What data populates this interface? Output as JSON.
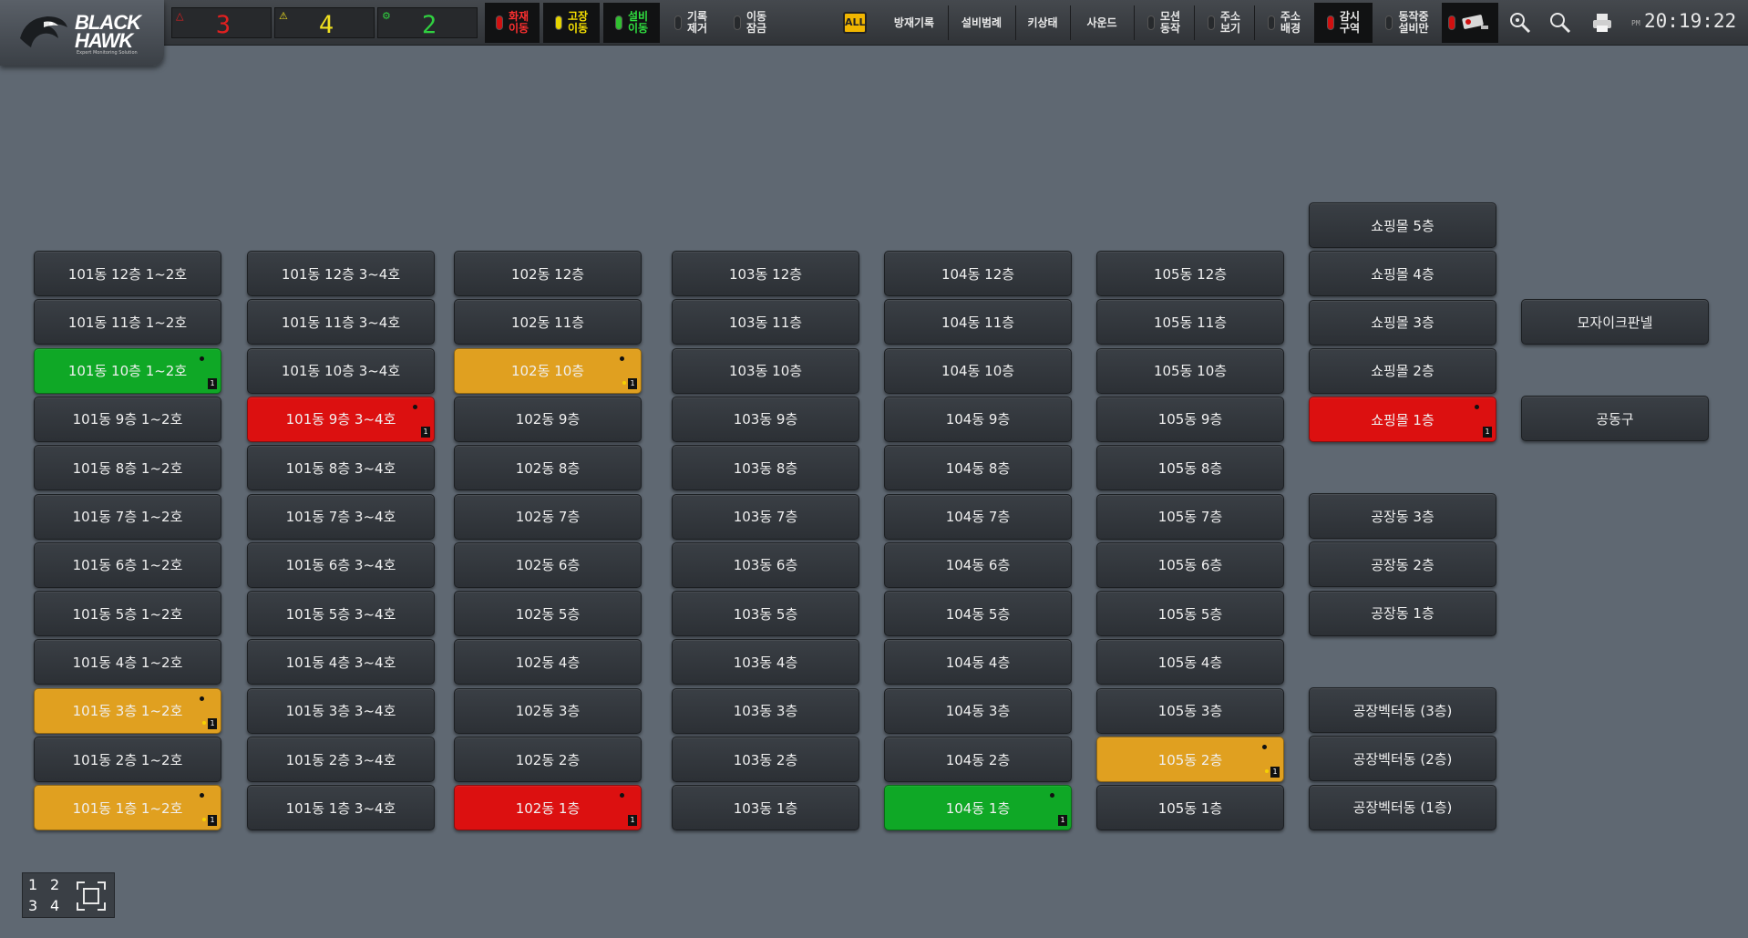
{
  "app": {
    "brand_line1": "BLACK",
    "brand_line2": "HAWK",
    "tagline": "Expert Monitoring Solution"
  },
  "counters": [
    {
      "icon": "fire-alarm-icon",
      "value": "3",
      "color": "#e02020"
    },
    {
      "icon": "warning-icon",
      "value": "4",
      "color": "#f0e020"
    },
    {
      "icon": "equipment-icon",
      "value": "2",
      "color": "#30d040"
    }
  ],
  "toolbar": {
    "fire_move": "화재\n이동",
    "fault_move": "고장\n이동",
    "equip_move": "설비\n이동",
    "clear_log": "기록\n제거",
    "move_lock": "이동\n잠금",
    "all_label": "ALL",
    "fire_log": "방재기록",
    "equip_list": "설비범례",
    "key_status": "키상태",
    "sound": "사운드",
    "mosin_action": "모션\n동작",
    "addr_view": "주소\n보기",
    "addr_change": "주소\n배경",
    "watch_zone": "감시\n구역",
    "running_only": "동작중\n설비만",
    "clock_ampm": "PM",
    "clock_time": "20:19:22"
  },
  "columns": [
    {
      "id": "101a",
      "cells": [
        {
          "label": "101동 12층 1~2호",
          "status": "normal"
        },
        {
          "label": "101동 11층 1~2호",
          "status": "normal"
        },
        {
          "label": "101동 10층 1~2호",
          "status": "green"
        },
        {
          "label": "101동 9층 1~2호",
          "status": "normal"
        },
        {
          "label": "101동 8층 1~2호",
          "status": "normal"
        },
        {
          "label": "101동 7층 1~2호",
          "status": "normal"
        },
        {
          "label": "101동 6층 1~2호",
          "status": "normal"
        },
        {
          "label": "101동 5층 1~2호",
          "status": "normal"
        },
        {
          "label": "101동 4층 1~2호",
          "status": "normal"
        },
        {
          "label": "101동 3층 1~2호",
          "status": "orange"
        },
        {
          "label": "101동 2층 1~2호",
          "status": "normal"
        },
        {
          "label": "101동 1층 1~2호",
          "status": "orange"
        }
      ]
    },
    {
      "id": "101b",
      "cells": [
        {
          "label": "101동 12층 3~4호",
          "status": "normal"
        },
        {
          "label": "101동 11층 3~4호",
          "status": "normal"
        },
        {
          "label": "101동 10층 3~4호",
          "status": "normal"
        },
        {
          "label": "101동 9층 3~4호",
          "status": "red"
        },
        {
          "label": "101동 8층 3~4호",
          "status": "normal"
        },
        {
          "label": "101동 7층 3~4호",
          "status": "normal"
        },
        {
          "label": "101동 6층 3~4호",
          "status": "normal"
        },
        {
          "label": "101동 5층 3~4호",
          "status": "normal"
        },
        {
          "label": "101동 4층 3~4호",
          "status": "normal"
        },
        {
          "label": "101동 3층 3~4호",
          "status": "normal"
        },
        {
          "label": "101동 2층 3~4호",
          "status": "normal"
        },
        {
          "label": "101동 1층 3~4호",
          "status": "normal"
        }
      ]
    },
    {
      "id": "102",
      "cells": [
        {
          "label": "102동 12층",
          "status": "normal"
        },
        {
          "label": "102동 11층",
          "status": "normal"
        },
        {
          "label": "102동 10층",
          "status": "orange"
        },
        {
          "label": "102동 9층",
          "status": "normal"
        },
        {
          "label": "102동 8층",
          "status": "normal"
        },
        {
          "label": "102동 7층",
          "status": "normal"
        },
        {
          "label": "102동 6층",
          "status": "normal"
        },
        {
          "label": "102동 5층",
          "status": "normal"
        },
        {
          "label": "102동 4층",
          "status": "normal"
        },
        {
          "label": "102동 3층",
          "status": "normal"
        },
        {
          "label": "102동 2층",
          "status": "normal"
        },
        {
          "label": "102동 1층",
          "status": "red"
        }
      ]
    },
    {
      "id": "103",
      "cells": [
        {
          "label": "103동 12층",
          "status": "normal"
        },
        {
          "label": "103동 11층",
          "status": "normal"
        },
        {
          "label": "103동 10층",
          "status": "normal"
        },
        {
          "label": "103동 9층",
          "status": "normal"
        },
        {
          "label": "103동 8층",
          "status": "normal"
        },
        {
          "label": "103동 7층",
          "status": "normal"
        },
        {
          "label": "103동 6층",
          "status": "normal"
        },
        {
          "label": "103동 5층",
          "status": "normal"
        },
        {
          "label": "103동 4층",
          "status": "normal"
        },
        {
          "label": "103동 3층",
          "status": "normal"
        },
        {
          "label": "103동 2층",
          "status": "normal"
        },
        {
          "label": "103동 1층",
          "status": "normal"
        }
      ]
    },
    {
      "id": "104",
      "cells": [
        {
          "label": "104동 12층",
          "status": "normal"
        },
        {
          "label": "104동 11층",
          "status": "normal"
        },
        {
          "label": "104동 10층",
          "status": "normal"
        },
        {
          "label": "104동 9층",
          "status": "normal"
        },
        {
          "label": "104동 8층",
          "status": "normal"
        },
        {
          "label": "104동 7층",
          "status": "normal"
        },
        {
          "label": "104동 6층",
          "status": "normal"
        },
        {
          "label": "104동 5층",
          "status": "normal"
        },
        {
          "label": "104동 4층",
          "status": "normal"
        },
        {
          "label": "104동 3층",
          "status": "normal"
        },
        {
          "label": "104동 2층",
          "status": "normal"
        },
        {
          "label": "104동 1층",
          "status": "green"
        }
      ]
    },
    {
      "id": "105",
      "cells": [
        {
          "label": "105동 12층",
          "status": "normal"
        },
        {
          "label": "105동 11층",
          "status": "normal"
        },
        {
          "label": "105동 10층",
          "status": "normal"
        },
        {
          "label": "105동 9층",
          "status": "normal"
        },
        {
          "label": "105동 8층",
          "status": "normal"
        },
        {
          "label": "105동 7층",
          "status": "normal"
        },
        {
          "label": "105동 6층",
          "status": "normal"
        },
        {
          "label": "105동 5층",
          "status": "normal"
        },
        {
          "label": "105동 4층",
          "status": "normal"
        },
        {
          "label": "105동 3층",
          "status": "normal"
        },
        {
          "label": "105동 2층",
          "status": "orange"
        },
        {
          "label": "105동 1층",
          "status": "normal"
        }
      ]
    }
  ],
  "mall": [
    {
      "label": "쇼핑몰 5층",
      "status": "normal"
    },
    {
      "label": "쇼핑몰 4층",
      "status": "normal"
    },
    {
      "label": "쇼핑몰 3층",
      "status": "normal"
    },
    {
      "label": "쇼핑몰 2층",
      "status": "normal"
    },
    {
      "label": "쇼핑몰 1층",
      "status": "red"
    }
  ],
  "factory": [
    {
      "label": "공장동 3층",
      "status": "normal"
    },
    {
      "label": "공장동 2층",
      "status": "normal"
    },
    {
      "label": "공장동 1층",
      "status": "normal"
    }
  ],
  "vector": [
    {
      "label": "공장벡터동 (3층)",
      "status": "normal"
    },
    {
      "label": "공장벡터동 (2층)",
      "status": "normal"
    },
    {
      "label": "공장벡터동 (1층)",
      "status": "normal"
    }
  ],
  "extra": [
    {
      "label": "모자이크판넬",
      "status": "normal"
    },
    {
      "label": "공동구",
      "status": "normal"
    }
  ],
  "layout_selector": {
    "d1": "1",
    "d2": "2",
    "d3": "3",
    "d4": "4"
  }
}
